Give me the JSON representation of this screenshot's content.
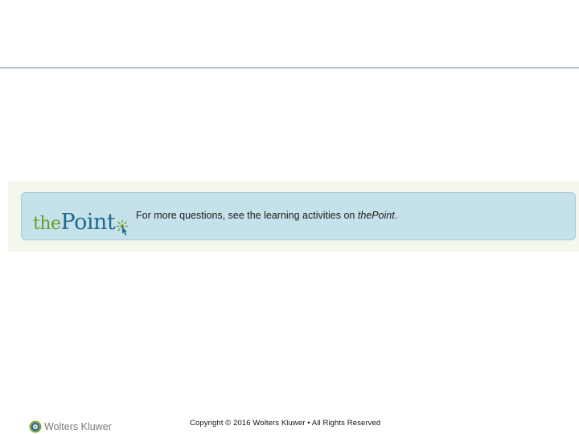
{
  "banner": {
    "logo_prefix": "the",
    "logo_main": "Point",
    "text_before": "For more questions, see the learning activities on ",
    "text_emphasis": "thePoint",
    "text_after": ".",
    "logo_mark_icon": "starburst-pointer-icon",
    "colors": {
      "banner_bg": "#c5e2ea",
      "logo_green": "#6c9a2a",
      "logo_blue": "#1f6a8f"
    }
  },
  "footer": {
    "company": "Wolters Kluwer",
    "company_icon": "wolters-kluwer-globe-icon",
    "copyright": "Copyright © 2016 Wolters Kluwer • All Rights Reserved"
  }
}
